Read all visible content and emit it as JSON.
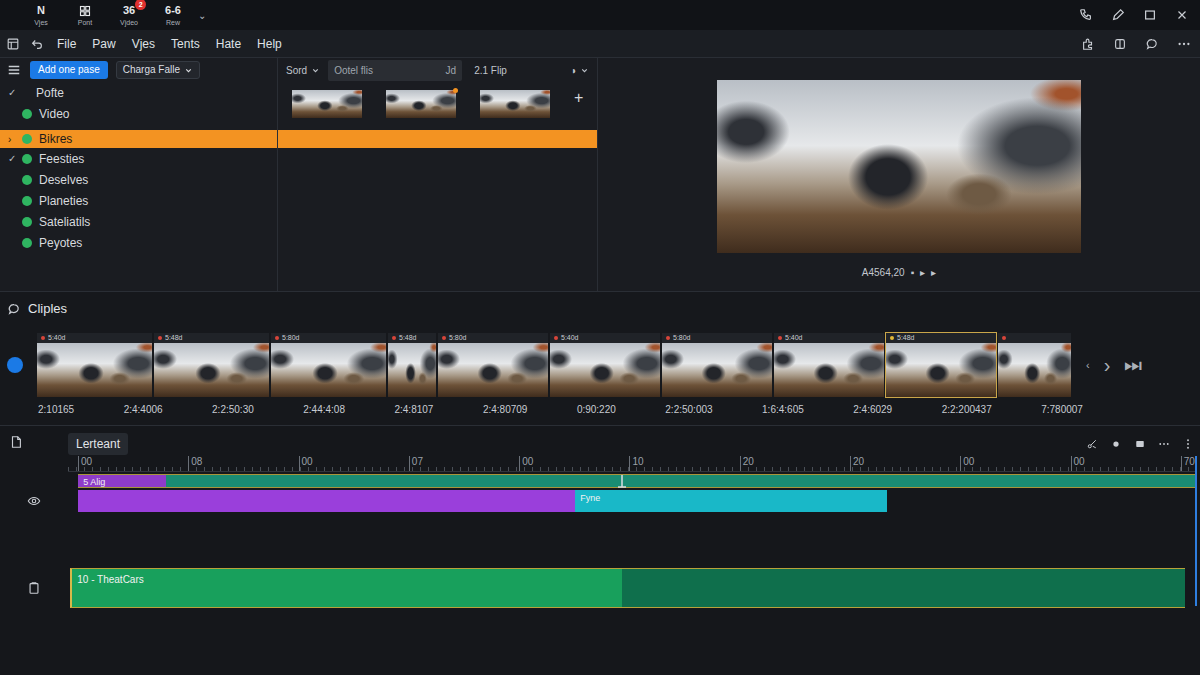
{
  "window": {
    "apps": [
      {
        "glyph": "N",
        "label": "Vjes"
      },
      {
        "label": "Pont"
      },
      {
        "glyph": "36",
        "badge": "2",
        "label": "Vjdeo"
      },
      {
        "glyph": "6-6",
        "label": "Rew"
      }
    ],
    "more": "⌄"
  },
  "menu": [
    "File",
    "Paw",
    "Vjes",
    "Tents",
    "Hate",
    "Help"
  ],
  "library": {
    "add_button": "Add one pase",
    "dropdown": "Charga Falle",
    "tree": [
      {
        "mark": "✓",
        "label": "Pofte",
        "kind": "group",
        "selected": false
      },
      {
        "label": "Video",
        "kind": "item",
        "selected": false
      },
      {
        "mark": "›",
        "label": "Bikres",
        "kind": "item",
        "selected": true
      },
      {
        "mark": "✓",
        "label": "Feesties",
        "kind": "item",
        "selected": false
      },
      {
        "label": "Deselves",
        "kind": "item",
        "selected": false
      },
      {
        "label": "Planeties",
        "kind": "item",
        "selected": false
      },
      {
        "label": "Sateliatils",
        "kind": "item",
        "selected": false
      },
      {
        "label": "Peyotes",
        "kind": "item",
        "selected": false
      }
    ]
  },
  "browser": {
    "sort": "Sord",
    "field": "Ootel flis",
    "field_suffix": "Jd",
    "clip_count": "2.1 Flip",
    "view": "◑",
    "thumbs": [
      {
        "flagged": false
      },
      {
        "flagged": true
      },
      {
        "flagged": false
      }
    ],
    "add": "+"
  },
  "preview": {
    "timecode": "A4564,20",
    "transport": [
      "▪",
      "▸",
      "▸"
    ]
  },
  "clips": {
    "title": "Cliples",
    "items": [
      {
        "label": "5:40d",
        "selected": false,
        "color": "#d8453a"
      },
      {
        "label": "5:48d",
        "selected": false,
        "color": "#d8453a"
      },
      {
        "label": "5:80d",
        "selected": false,
        "color": "#d8453a"
      },
      {
        "label": "5:48d",
        "selected": false,
        "color": "#d8453a"
      },
      {
        "label": "5:80d",
        "selected": false,
        "color": "#d8453a"
      },
      {
        "label": "5:40d",
        "selected": false,
        "color": "#d8453a"
      },
      {
        "label": "5:80d",
        "selected": false,
        "color": "#d8453a"
      },
      {
        "label": "5:40d",
        "selected": false,
        "color": "#d8453a"
      },
      {
        "label": "5:48d",
        "selected": true,
        "color": "#e0b838"
      },
      {
        "label": "",
        "selected": false,
        "color": "#d8453a"
      }
    ],
    "timecodes": [
      "2:10165",
      "2:4:4006",
      "2:2:50:30",
      "2:44:4:08",
      "2:4:8107",
      "2:4:80709",
      "0:90:220",
      "2:2:50:003",
      "1:6:4:605",
      "2:4:6029",
      "2:2:200437",
      "7:780007"
    ],
    "nav": [
      "‹",
      "›",
      "⏭"
    ]
  },
  "timeline": {
    "tab": "Lerteant",
    "ruler": [
      "00",
      "08",
      "00",
      "07",
      "00",
      "10",
      "20",
      "20",
      "00",
      "00",
      "70"
    ],
    "playhead": 0.492,
    "tracks": [
      {
        "kind": "video",
        "clips": [
          {
            "label": "5 Alig",
            "start": 0.009,
            "end": 0.087,
            "color": "#8e3cc9"
          },
          {
            "start": 0.087,
            "end": 1.0,
            "color": "#1a8c73"
          }
        ]
      },
      {
        "kind": "video",
        "clips": [
          {
            "start": 0.009,
            "end": 0.45,
            "color": "#9a3fdb"
          },
          {
            "label": "Fyne",
            "start": 0.45,
            "end": 0.727,
            "color": "#19b8c8"
          }
        ]
      },
      {
        "kind": "audio",
        "clips": [
          {
            "label": "10 - TheatCars",
            "start": 0.002,
            "end": 0.492,
            "color": "#18a05c"
          },
          {
            "start": 0.492,
            "end": 0.991,
            "color": "#0f6f4c"
          }
        ]
      }
    ]
  }
}
